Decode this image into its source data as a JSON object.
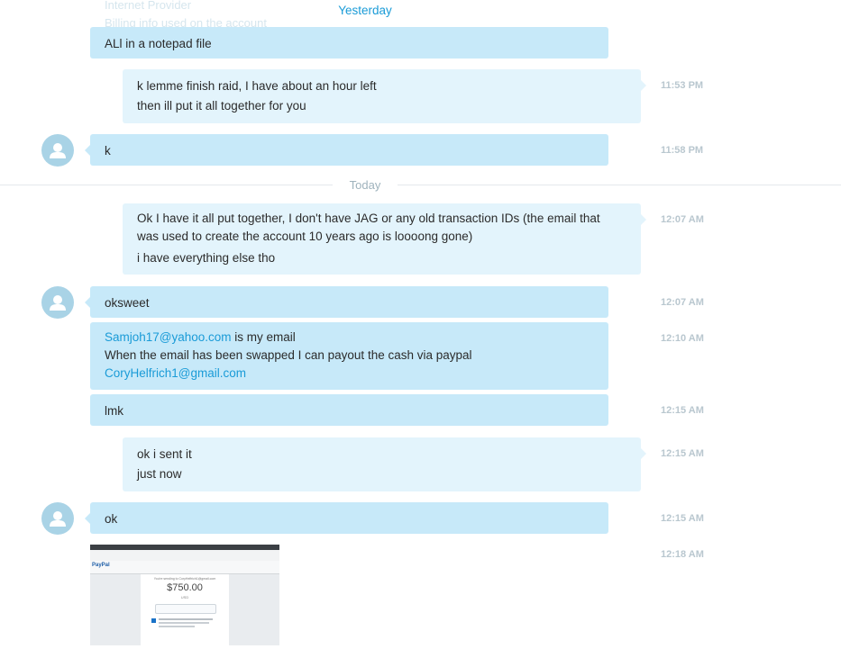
{
  "colors": {
    "incoming_bubble": "#c7e9f9",
    "outgoing_bubble": "#e3f4fc",
    "link": "#1a9bd7",
    "timestamp": "#b9c7cf",
    "avatar": "#a9d3e6"
  },
  "dividers": {
    "yesterday": "Yesterday",
    "today": "Today"
  },
  "faded_top": {
    "line1": "Internet Provider",
    "line2": "Billing info used on the account"
  },
  "messages": {
    "m0": {
      "direction": "incoming",
      "lines": [
        "ALl in a notepad file"
      ]
    },
    "m1": {
      "direction": "outgoing",
      "lines": [
        "k lemme finish raid, I have about an hour left",
        "then ill put it all together for you"
      ],
      "time": "11:53 PM"
    },
    "m2": {
      "direction": "incoming",
      "lines": [
        "k"
      ],
      "time": "11:58 PM"
    },
    "m3": {
      "direction": "outgoing",
      "lines": [
        "Ok I have it all put together, I don't have JAG or any old transaction IDs (the email that",
        "was used to create the account 10 years ago is loooong gone)",
        "i have everything else tho"
      ],
      "time": "12:07 AM"
    },
    "m4": {
      "direction": "incoming",
      "lines": [
        "oksweet"
      ],
      "time": "12:07 AM"
    },
    "m5": {
      "direction": "incoming",
      "link1": "Samjoh17@yahoo.com",
      "text1": " is my email",
      "line2": "When the email has been swapped I can payout the cash via paypal",
      "link2": "CoryHelfrich1@gmail.com",
      "time": "12:10 AM"
    },
    "m6": {
      "direction": "incoming",
      "lines": [
        "lmk"
      ],
      "time": "12:15 AM"
    },
    "m7": {
      "direction": "outgoing",
      "lines": [
        "ok i sent it",
        "just now"
      ],
      "time": "12:15 AM"
    },
    "m8": {
      "direction": "incoming",
      "lines": [
        "ok"
      ],
      "time": "12:15 AM"
    },
    "m9": {
      "direction": "incoming",
      "kind": "image",
      "time": "12:18 AM"
    }
  },
  "image_preview": {
    "brand": "PayPal",
    "sending_to": "You're sending to CoryHelfrich1@gmail.com",
    "amount": "$750.00",
    "currency": "USD"
  }
}
